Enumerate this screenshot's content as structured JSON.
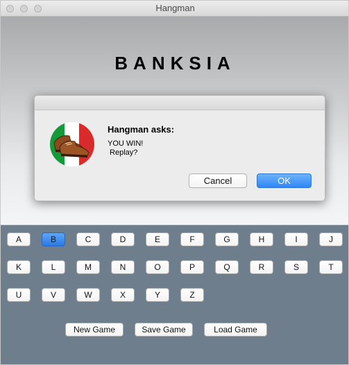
{
  "window": {
    "title": "Hangman"
  },
  "game": {
    "word": "BANKSIA",
    "selected_letter": "B",
    "rows": [
      [
        "A",
        "B",
        "C",
        "D",
        "E",
        "F",
        "G",
        "H",
        "I",
        "J"
      ],
      [
        "K",
        "L",
        "M",
        "N",
        "O",
        "P",
        "Q",
        "R",
        "S",
        "T"
      ],
      [
        "U",
        "V",
        "W",
        "X",
        "Y",
        "Z"
      ]
    ],
    "commands": {
      "new_game": "New Game",
      "save_game": "Save Game",
      "load_game": "Load Game"
    }
  },
  "dialog": {
    "title": "Hangman asks:",
    "message": "YOU WIN!\n Replay?",
    "cancel_label": "Cancel",
    "ok_label": "OK",
    "icon": "shoes-on-italian-flag-icon",
    "colors": {
      "flag_green": "#159a3b",
      "flag_white": "#ffffff",
      "flag_red": "#d92b2b",
      "ok_blue": "#2f86f5"
    }
  },
  "colors": {
    "keyboard_bg": "#6e7e8d",
    "selected_key": "#2a7ae8"
  }
}
